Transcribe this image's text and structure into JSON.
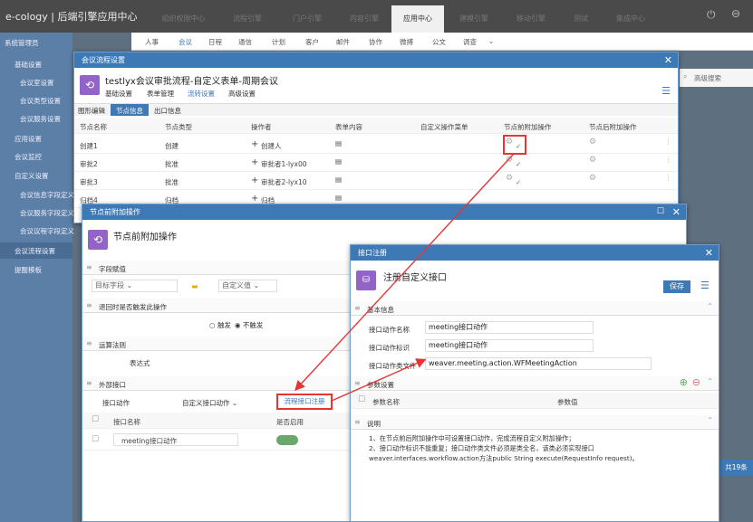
{
  "brand": "e-cology | 后端引擎应用中心",
  "top_tabs": [
    "组织权限中心",
    "流程引擎",
    "门户引擎",
    "内容引擎",
    "应用中心",
    "建模引擎",
    "移动引擎",
    "测试",
    "集成中心"
  ],
  "sub_nav": [
    "人事",
    "会议",
    "日程",
    "通信",
    "计划",
    "客户",
    "邮件",
    "协作",
    "微搏",
    "公文",
    "调查"
  ],
  "sidebar": {
    "title": "系统管理员",
    "items": [
      "基础设置",
      "会议室设置",
      "会议类型设置",
      "会议服务设置",
      "应用设置",
      "会议监控",
      "自定义设置",
      "会议信息字段定义",
      "会议服务字段定义",
      "会议议程字段定义",
      "会议流程设置",
      "提醒模板"
    ]
  },
  "adv_search": "高级搜索",
  "total": "共19条",
  "dlg1": {
    "title": "会议流程设置",
    "heading": "testlyx会议审批流程-自定义表单-周期会议",
    "tabs": [
      "基础设置",
      "表单管理",
      "流转设置",
      "高级设置"
    ],
    "subtabs": [
      "图形编辑",
      "节点信息",
      "出口信息"
    ],
    "cols": [
      "节点名称",
      "节点类型",
      "操作者",
      "表单内容",
      "自定义操作菜单",
      "节点前附加操作",
      "节点后附加操作"
    ],
    "rows": [
      {
        "name": "创建1",
        "type": "创建",
        "op": "创建人"
      },
      {
        "name": "审批2",
        "type": "批准",
        "op": "审批者1-lyx00"
      },
      {
        "name": "审批3",
        "type": "批准",
        "op": "审批者2-lyx10"
      },
      {
        "name": "归档4",
        "type": "归档",
        "op": "归档"
      }
    ]
  },
  "dlg2": {
    "title": "节点前附加操作",
    "heading": "节点前附加操作",
    "sec_field": "字段赋值",
    "target": "目标字段",
    "custom_val": "自定义值",
    "sec_return": "退回时是否触发此操作",
    "trigger": "触发",
    "not_trigger": "不触发",
    "sec_rule": "运算法则",
    "expr": "表达式",
    "sec_ext": "外部接口",
    "iface_action": "接口动作",
    "custom_action": "自定义接口动作",
    "reg_btn": "流程接口注册",
    "col_name": "接口名称",
    "col_enable": "是否启用",
    "row_name": "meeting接口动作"
  },
  "dlg3": {
    "title": "接口注册",
    "heading": "注册自定义接口",
    "save": "保存",
    "sec_basic": "基本信息",
    "l_name": "接口动作名称",
    "v_name": "meeting接口动作",
    "l_id": "接口动作标识",
    "v_id": "meeting接口动作",
    "l_class": "接口动作类文件",
    "v_class": "weaver.meeting.action.WFMeetingAction",
    "sec_param": "参数设置",
    "p_name": "参数名称",
    "p_val": "参数值",
    "sec_desc": "说明",
    "desc1": "1、在节点前后附加操作中可设置接口动作，完成流程自定义附加操作；",
    "desc2": "2、接口动作标识不能重复；接口动作类文件必须是类全名，该类必须实现接口",
    "desc3": "weaver.interfaces.workflow.action方法public String execute(RequestInfo request)。"
  }
}
